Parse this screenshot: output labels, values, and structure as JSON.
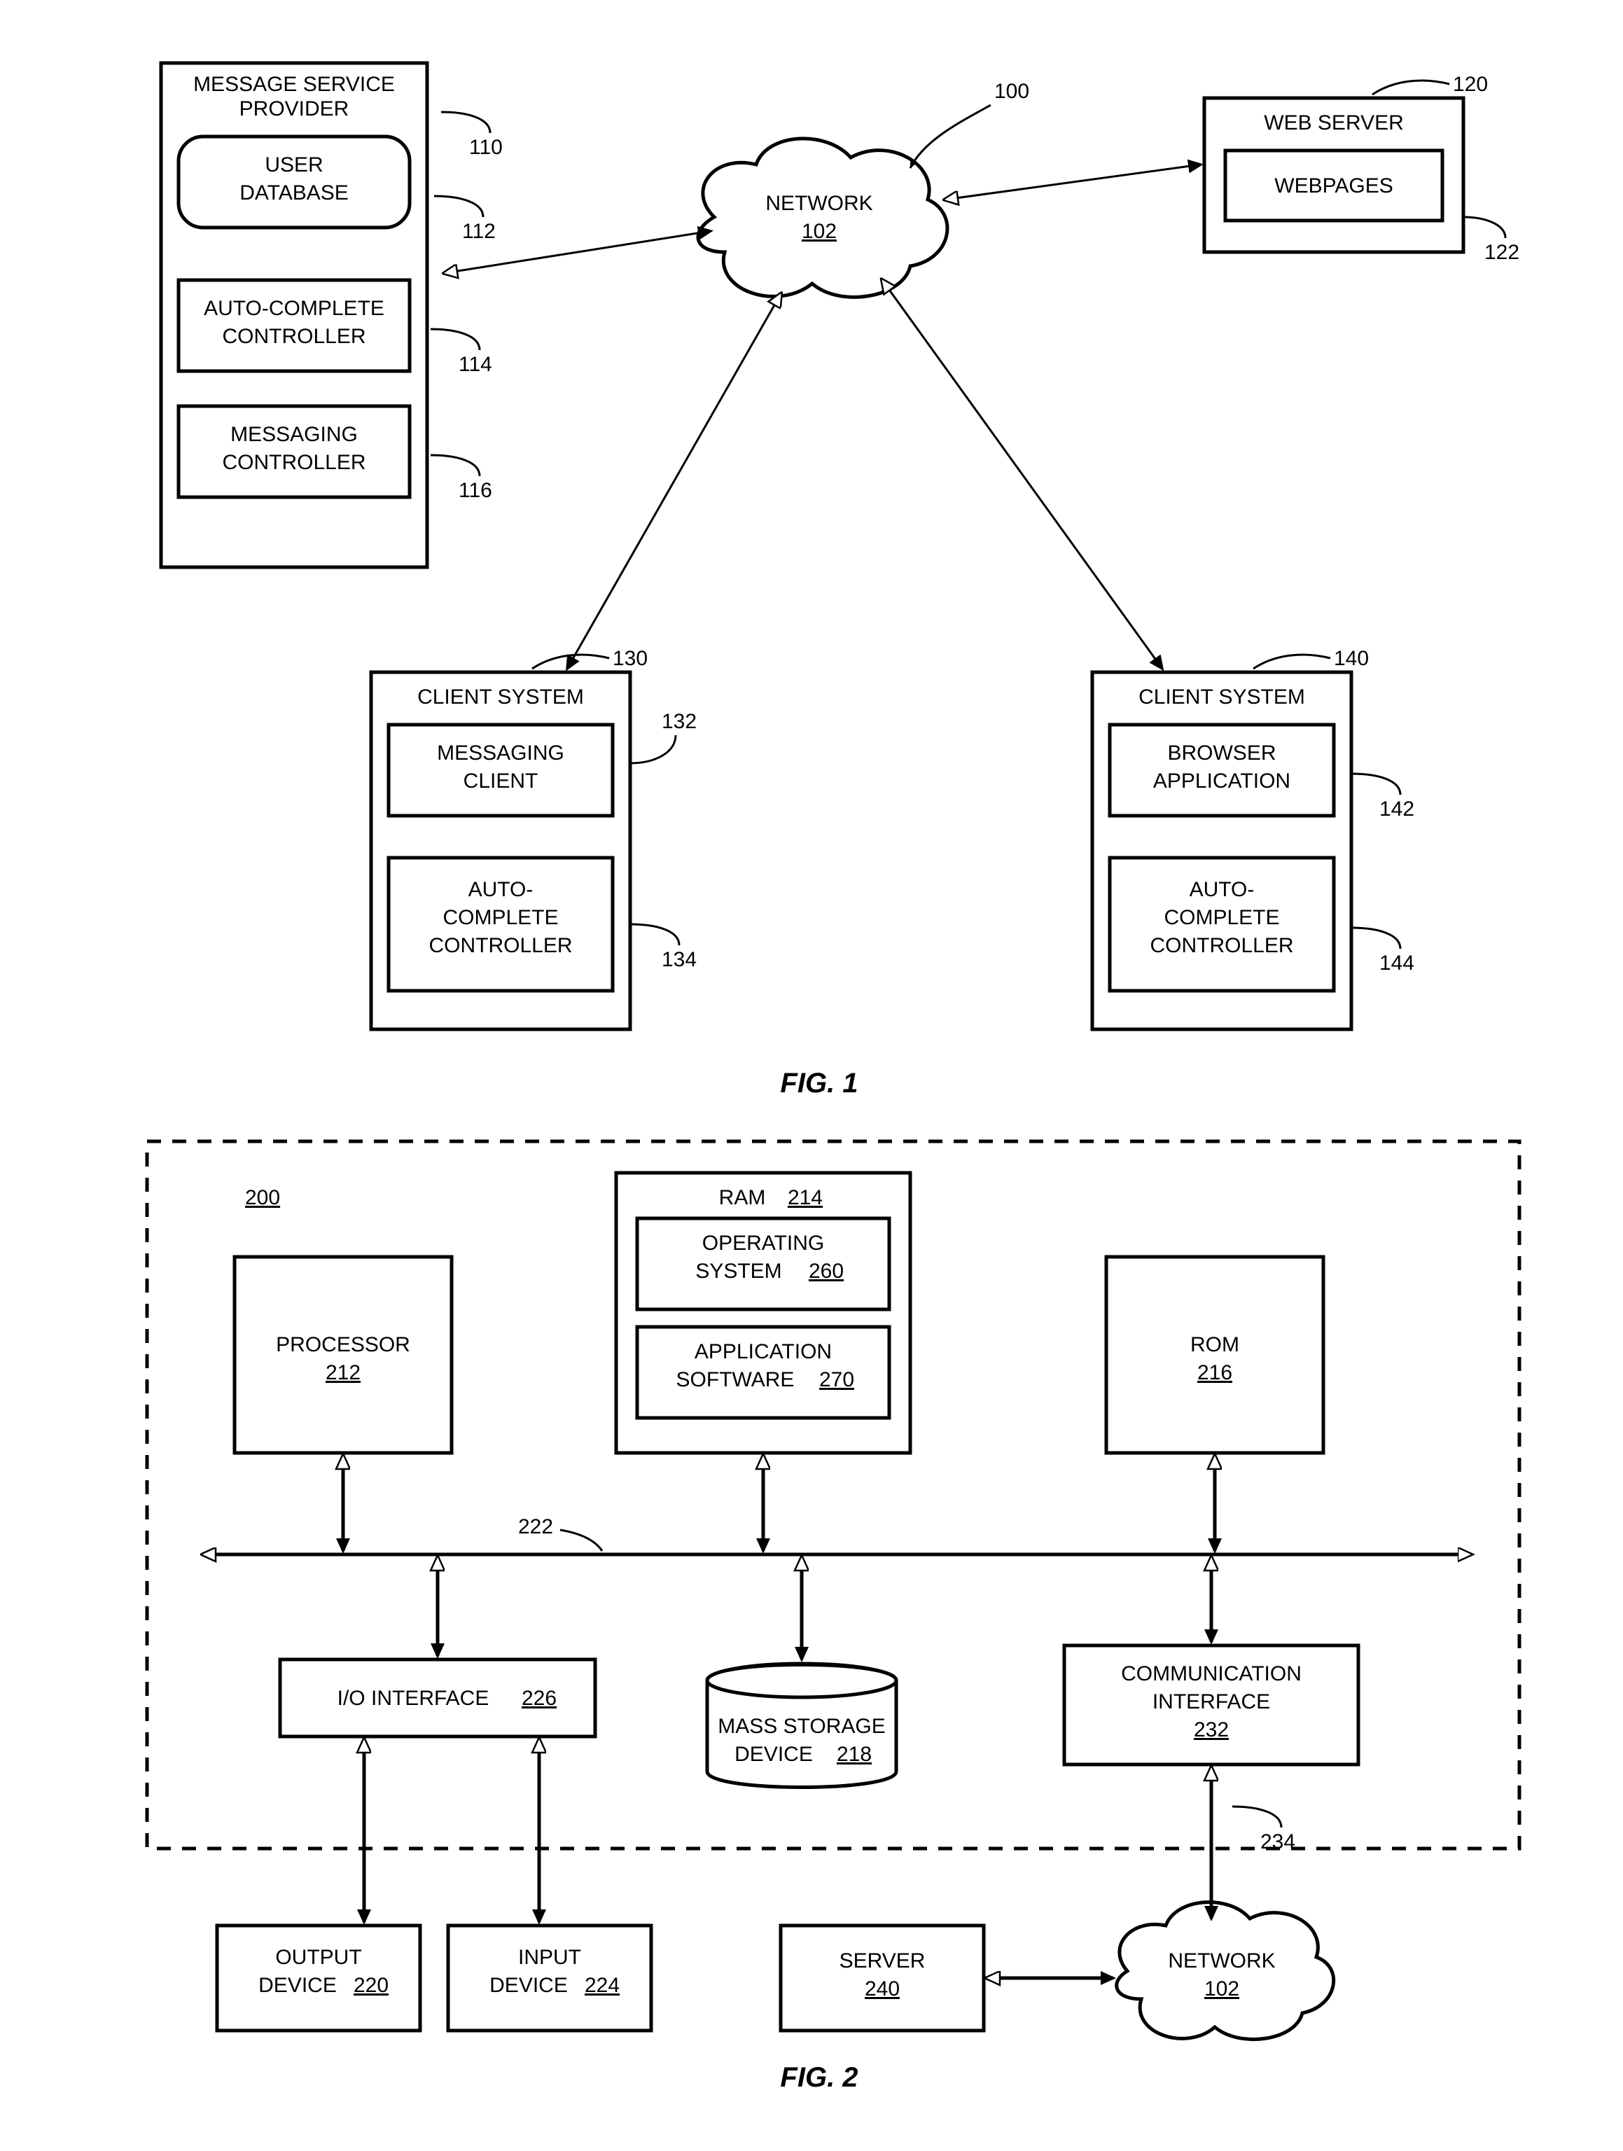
{
  "fig1": {
    "caption": "FIG. 1",
    "refs": {
      "overall": "100",
      "network": "102",
      "msp": "110",
      "userdb": "112",
      "autocomp_msp": "114",
      "msgctrl": "116",
      "webserver": "120",
      "webpages": "122",
      "client1": "130",
      "msgclient": "132",
      "autocomp_c1": "134",
      "client2": "140",
      "browserapp": "142",
      "autocomp_c2": "144"
    },
    "labels": {
      "network": "NETWORK",
      "msp": "MESSAGE SERVICE\nPROVIDER",
      "userdb": "USER\nDATABASE",
      "auto_msp": "AUTO-COMPLETE\nCONTROLLER",
      "msgctrl": "MESSAGING\nCONTROLLER",
      "webserver": "WEB SERVER",
      "webpages": "WEBPAGES",
      "client1": "CLIENT SYSTEM",
      "msgclient": "MESSAGING\nCLIENT",
      "auto_c1": "AUTO-\nCOMPLETE\nCONTROLLER",
      "client2": "CLIENT SYSTEM",
      "browserapp": "BROWSER\nAPPLICATION",
      "auto_c2": "AUTO-\nCOMPLETE\nCONTROLLER"
    }
  },
  "fig2": {
    "caption": "FIG. 2",
    "refs": {
      "overall": "200",
      "processor": "212",
      "ram": "214",
      "rom": "216",
      "mass": "218",
      "output": "220",
      "bus": "222",
      "input": "224",
      "io": "226",
      "comm": "232",
      "commlink": "234",
      "server": "240",
      "os": "260",
      "app": "270",
      "network": "102"
    },
    "labels": {
      "processor": "PROCESSOR",
      "ram": "RAM",
      "os": "OPERATING\nSYSTEM",
      "app": "APPLICATION\nSOFTWARE",
      "rom": "ROM",
      "io": "I/O INTERFACE",
      "mass": "MASS STORAGE\nDEVICE",
      "comm": "COMMUNICATION\nINTERFACE",
      "output": "OUTPUT\nDEVICE",
      "input": "INPUT\nDEVICE",
      "server": "SERVER",
      "network": "NETWORK"
    }
  }
}
